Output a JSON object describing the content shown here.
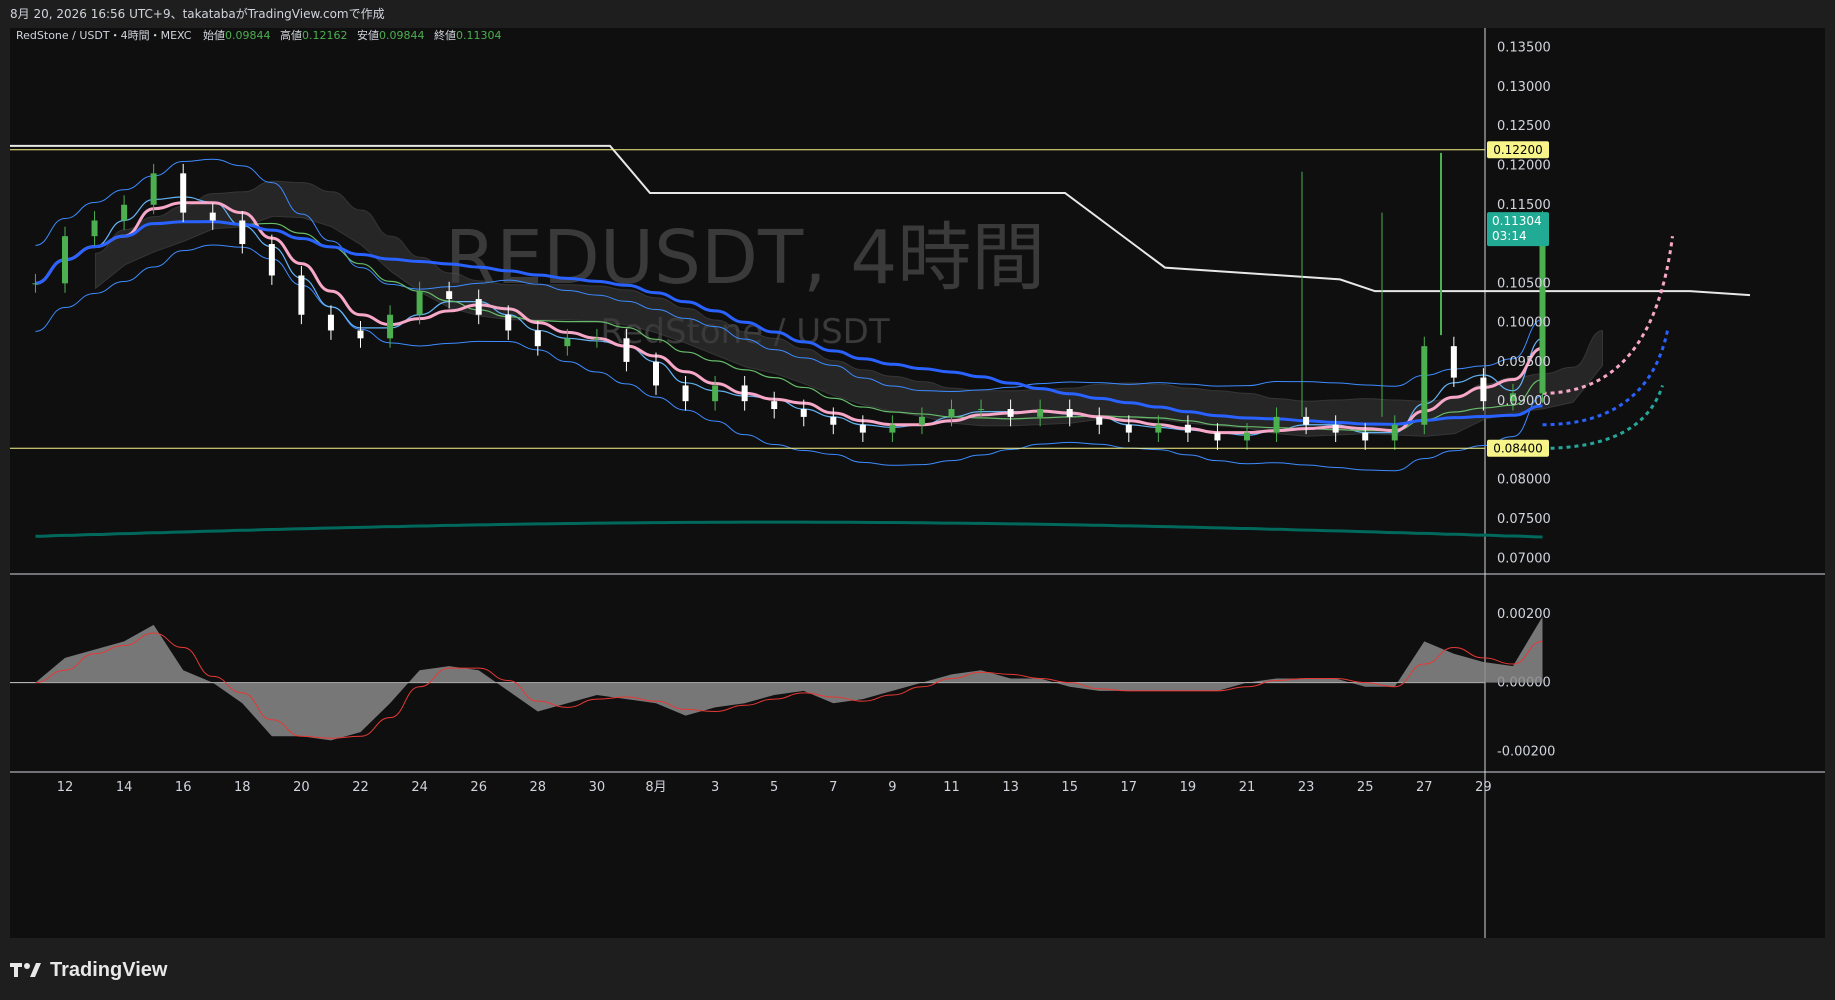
{
  "header": {
    "caption": "8月 20, 2026 16:56 UTC+9、takatabaがTradingView.comで作成"
  },
  "legend": {
    "symbol": "RedStone / USDT・4時間・MEXC",
    "open_label": "始値",
    "open_value": "0.09844",
    "high_label": "高値",
    "high_value": "0.12162",
    "low_label": "安値",
    "low_value": "0.09844",
    "close_label": "終値",
    "close_value": "0.11304"
  },
  "watermark": {
    "main": "REDUSDT, 4時間",
    "sub": "RedStone / USDT"
  },
  "price_tag": {
    "value": "0.11304",
    "countdown": "03:14"
  },
  "levels": {
    "upper": "0.12200",
    "lower": "0.08400"
  },
  "brand": {
    "name": "TradingView"
  },
  "colors": {
    "background": "#0f0f0f",
    "up": "#4caf50",
    "down": "#ffffff",
    "level_line": "#f7f58a",
    "ma_blue": "#2962ff",
    "ma_pink": "#f7a8c8",
    "ma_green": "#66bb6a",
    "ma_teal": "#00695c",
    "bollinger": "#3d8bff",
    "price_tag_bg": "#22ab94",
    "level_tag_bg": "#f7f58a"
  },
  "chart_data": {
    "type": "line",
    "title": "REDUSDT, 4時間",
    "y_axis": {
      "ticks": [
        "0.13500",
        "0.13000",
        "0.12500",
        "0.12000",
        "0.11500",
        "0.10500",
        "0.10000",
        "0.09500",
        "0.09000",
        "0.08000",
        "0.07500",
        "0.07000"
      ],
      "range": [
        0.068,
        0.1375
      ]
    },
    "x_axis": {
      "ticks": [
        "12",
        "14",
        "16",
        "18",
        "20",
        "22",
        "24",
        "26",
        "28",
        "30",
        "8月",
        "3",
        "5",
        "7",
        "9",
        "11",
        "13",
        "15",
        "17",
        "19",
        "21",
        "23",
        "25",
        "27",
        "29"
      ]
    },
    "price_series": {
      "name": "close",
      "x": [
        11,
        12,
        13,
        14,
        15,
        16,
        17,
        18,
        19,
        20,
        21,
        22,
        23,
        24,
        25,
        26,
        27,
        28,
        29,
        30,
        31,
        32,
        33,
        34,
        35,
        36,
        37,
        38,
        39,
        40,
        41,
        42,
        43,
        44,
        45,
        46,
        47,
        48,
        49,
        50,
        51,
        52,
        53,
        54,
        55,
        56,
        57,
        58,
        59,
        60,
        61,
        62
      ],
      "values": [
        0.105,
        0.111,
        0.113,
        0.115,
        0.119,
        0.114,
        0.113,
        0.11,
        0.106,
        0.101,
        0.099,
        0.098,
        0.101,
        0.104,
        0.103,
        0.101,
        0.099,
        0.097,
        0.098,
        0.098,
        0.095,
        0.092,
        0.09,
        0.092,
        0.09,
        0.089,
        0.088,
        0.087,
        0.086,
        0.087,
        0.088,
        0.089,
        0.089,
        0.088,
        0.089,
        0.088,
        0.087,
        0.086,
        0.087,
        0.086,
        0.085,
        0.086,
        0.088,
        0.087,
        0.086,
        0.085,
        0.087,
        0.097,
        0.093,
        0.09,
        0.091,
        0.113
      ]
    },
    "oscillator": {
      "ticks": [
        "0.00200",
        "0.00000",
        "-0.00200"
      ],
      "range": [
        -0.0026,
        0.0031
      ]
    },
    "levels": [
      0.122,
      0.084
    ],
    "last_price": 0.11304
  }
}
